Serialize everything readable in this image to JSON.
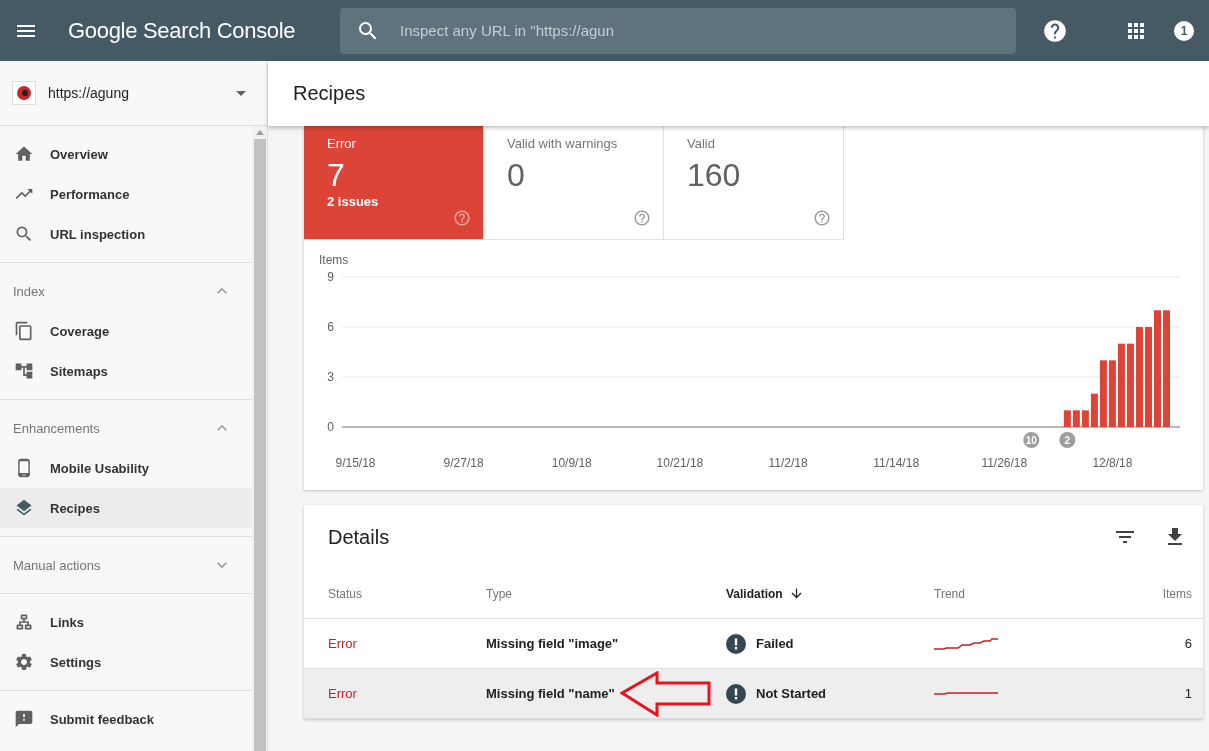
{
  "header": {
    "product": "Google Search Console",
    "search": {
      "placeholder": "Inspect any URL in \"https://agun"
    },
    "account_badge": "1"
  },
  "property": {
    "url": "https://agung"
  },
  "sidebar": {
    "sections": [
      {
        "items": [
          {
            "label": "Overview",
            "selected": false
          },
          {
            "label": "Performance",
            "selected": false
          },
          {
            "label": "URL inspection",
            "selected": false
          }
        ]
      },
      {
        "title": "Index",
        "expanded": true,
        "items": [
          {
            "label": "Coverage",
            "selected": false
          },
          {
            "label": "Sitemaps",
            "selected": false
          }
        ]
      },
      {
        "title": "Enhancements",
        "expanded": true,
        "items": [
          {
            "label": "Mobile Usability",
            "selected": false
          },
          {
            "label": "Recipes",
            "selected": true
          }
        ]
      },
      {
        "title": "Manual actions",
        "expanded": false
      },
      {
        "items": [
          {
            "label": "Links",
            "selected": false
          },
          {
            "label": "Settings",
            "selected": false
          }
        ]
      },
      {
        "items": [
          {
            "label": "Submit feedback",
            "selected": false
          }
        ]
      }
    ]
  },
  "page_title": "Recipes",
  "summary": [
    {
      "label": "Error",
      "value": "7",
      "sub": "2 issues",
      "selected": true
    },
    {
      "label": "Valid with warnings",
      "value": "0",
      "selected": false
    },
    {
      "label": "Valid",
      "value": "160",
      "selected": false
    }
  ],
  "chart_data": {
    "type": "bar",
    "ylabel": "Items",
    "categories": [
      "9/15/18",
      null,
      null,
      null,
      null,
      null,
      null,
      null,
      null,
      null,
      null,
      null,
      "9/27/18",
      null,
      null,
      null,
      null,
      null,
      null,
      null,
      null,
      null,
      null,
      null,
      "10/9/18",
      null,
      null,
      null,
      null,
      null,
      null,
      null,
      null,
      null,
      null,
      null,
      "10/21/18",
      null,
      null,
      null,
      null,
      null,
      null,
      null,
      null,
      null,
      null,
      null,
      "11/2/18",
      null,
      null,
      null,
      null,
      null,
      null,
      null,
      null,
      null,
      null,
      null,
      "11/14/18",
      null,
      null,
      null,
      null,
      null,
      null,
      null,
      null,
      null,
      null,
      null,
      "11/26/18",
      null,
      null,
      null,
      null,
      null,
      null,
      null,
      null,
      null,
      null,
      null,
      "12/8/18",
      null,
      null,
      null,
      null,
      null,
      null
    ],
    "values": [
      null,
      null,
      null,
      null,
      null,
      null,
      null,
      null,
      null,
      null,
      null,
      null,
      null,
      null,
      null,
      null,
      null,
      null,
      null,
      null,
      null,
      null,
      null,
      null,
      null,
      null,
      null,
      null,
      null,
      null,
      null,
      null,
      null,
      null,
      null,
      null,
      null,
      null,
      null,
      null,
      null,
      null,
      null,
      null,
      null,
      null,
      null,
      null,
      null,
      null,
      null,
      null,
      null,
      null,
      null,
      null,
      null,
      null,
      null,
      null,
      null,
      null,
      null,
      null,
      null,
      null,
      null,
      null,
      null,
      null,
      null,
      null,
      null,
      null,
      null,
      null,
      null,
      null,
      null,
      1,
      1,
      1,
      2,
      4,
      4,
      5,
      5,
      6,
      6,
      7,
      7
    ],
    "ylim": [
      0,
      9
    ],
    "yticks": [
      0,
      3,
      6,
      9
    ],
    "annotations": [
      "10",
      "2"
    ]
  },
  "details": {
    "title": "Details",
    "columns": [
      {
        "label": "Status",
        "sorted": false
      },
      {
        "label": "Type",
        "sorted": false
      },
      {
        "label": "Validation",
        "sorted": true
      },
      {
        "label": "Trend",
        "sorted": false
      },
      {
        "label": "Items",
        "sorted": false
      }
    ],
    "rows": [
      {
        "status": "Error",
        "type": "Missing field \"image\"",
        "validation": "Failed",
        "items": "6",
        "selected": false
      },
      {
        "status": "Error",
        "type": "Missing field \"name\"",
        "validation": "Not Started",
        "items": "1",
        "selected": true
      }
    ]
  }
}
